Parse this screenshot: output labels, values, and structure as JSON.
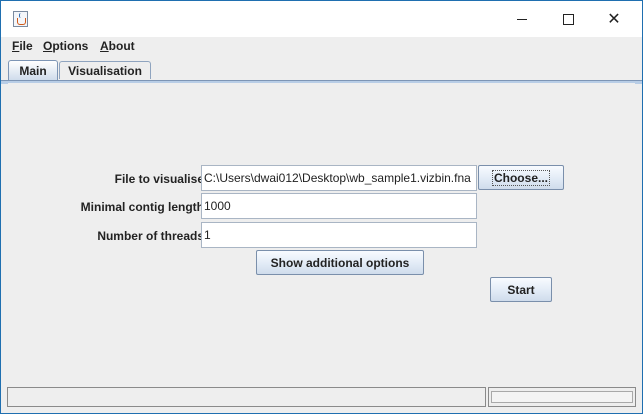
{
  "window": {
    "icons": {
      "app": "java-cup-icon",
      "minimize": "minimize-icon",
      "maximize": "maximize-icon",
      "close": "close-icon"
    },
    "close_glyph": "✕"
  },
  "menu": [
    {
      "label": "File",
      "mnemonic": "F",
      "rest": "ile"
    },
    {
      "label": "Options",
      "mnemonic": "O",
      "rest": "ptions"
    },
    {
      "label": "About",
      "mnemonic": "A",
      "rest": "bout"
    }
  ],
  "tabs": [
    {
      "label": "Main",
      "active": true
    },
    {
      "label": "Visualisation",
      "active": false
    }
  ],
  "form": {
    "file_label": "File to visualise:",
    "file_value": "C:\\Users\\dwai012\\Desktop\\wb_sample1.vizbin.fna",
    "choose_button": "Choose...",
    "contig_label": "Minimal contig length:",
    "contig_value": "1000",
    "threads_label": "Number of threads:",
    "threads_value": "1",
    "additional_button": "Show additional options",
    "start_button": "Start"
  },
  "status": {
    "text": ""
  },
  "colors": {
    "accent_border": "#1f6fb0",
    "tab_active": "#cfdcec",
    "panel": "#eeeeee"
  }
}
